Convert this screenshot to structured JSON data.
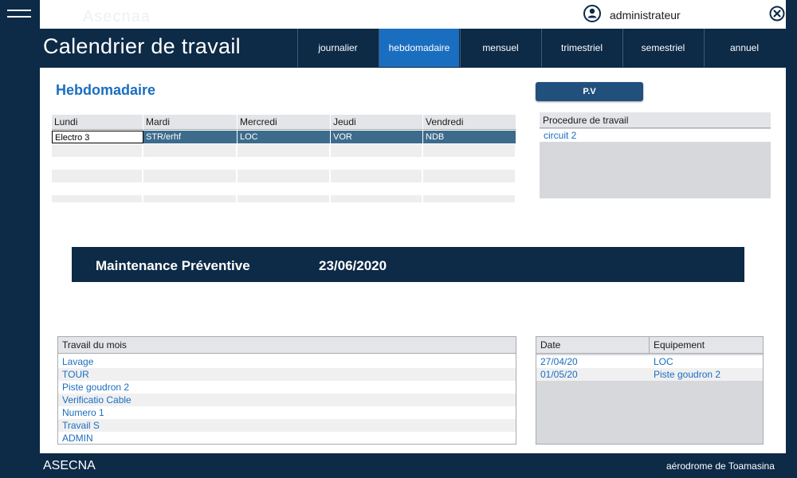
{
  "app": {
    "ghost_title": "Asecnaa",
    "page_title": "Calendrier de travail",
    "user_name": "administrateur"
  },
  "tabs": [
    {
      "label": "journalier",
      "active": false
    },
    {
      "label": "hebdomadaire",
      "active": true
    },
    {
      "label": "mensuel",
      "active": false
    },
    {
      "label": "trimestriel",
      "active": false
    },
    {
      "label": "semestriel",
      "active": false
    },
    {
      "label": "annuel",
      "active": false
    }
  ],
  "section": {
    "title": "Hebdomadaire",
    "pv_button_label": "P.V"
  },
  "weekly": {
    "columns": [
      "Lundi",
      "Mardi",
      "Mercredi",
      "Jeudi",
      "Vendredi"
    ],
    "row": [
      "Electro 3",
      "STR/erhf",
      "LOC",
      "VOR",
      "NDB"
    ]
  },
  "procedure": {
    "header": "Procedure de travail",
    "items": [
      "circuit 2"
    ]
  },
  "banner": {
    "title": "Maintenance Préventive",
    "date": "23/06/2020"
  },
  "monthly": {
    "header": "Travail du mois",
    "items": [
      "Lavage",
      "TOUR",
      "Piste goudron 2",
      "Verificatio Cable",
      "Numero 1",
      "Travail S",
      "ADMIN"
    ]
  },
  "schedule": {
    "headers": [
      "Date",
      "Equipement"
    ],
    "rows": [
      {
        "date": "27/04/20",
        "equipment": "LOC"
      },
      {
        "date": "01/05/20",
        "equipment": "Piste goudron 2"
      }
    ]
  },
  "footer": {
    "left": "ASECNA",
    "right": "aérodrome de Toamasina"
  },
  "colors": {
    "navy": "#0d2a47",
    "accent": "#1a6ec0",
    "selection": "#3d6b8c"
  },
  "icons": {
    "menu": "hamburger-menu-icon",
    "user": "user-circle-icon",
    "close": "close-circle-icon"
  }
}
